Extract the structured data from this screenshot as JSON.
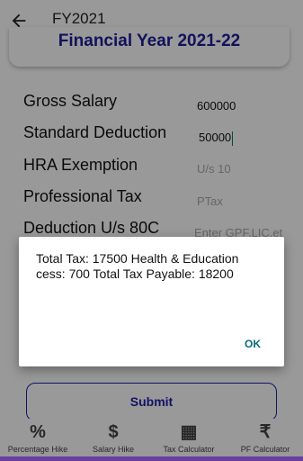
{
  "appbar": {
    "title": "FY2021",
    "back_icon": "arrow-left-icon"
  },
  "card": {
    "title": "Financial Year 2021-22"
  },
  "form": {
    "rows": [
      {
        "label": "Gross Salary",
        "value": "600000",
        "placeholder": ""
      },
      {
        "label": "Standard Deduction",
        "value": "50000",
        "placeholder": ""
      },
      {
        "label": "HRA Exemption",
        "value": "",
        "placeholder": "U/s 10"
      },
      {
        "label": "Professional Tax",
        "value": "",
        "placeholder": "PTax"
      },
      {
        "label": "Deduction U/s 80C",
        "value": "",
        "placeholder": "Enter GPF,LIC,et"
      }
    ],
    "submit_label": "Submit"
  },
  "bottom_nav": [
    {
      "icon": "percent-icon",
      "glyph": "%",
      "label": "Percentage Hike"
    },
    {
      "icon": "dollar-icon",
      "glyph": "$",
      "label": "Salary Hike"
    },
    {
      "icon": "calculator-icon",
      "glyph": "▦",
      "label": "Tax Calculator"
    },
    {
      "icon": "rupee-icon",
      "glyph": "₹",
      "label": "PF Calculator"
    }
  ],
  "dialog": {
    "message": "Total Tax: 17500 Health & Education cess: 700 Total Tax Payable: 18200",
    "ok_label": "OK"
  },
  "colors": {
    "accent": "#1e1ea8",
    "dialog_button": "#0a6b7a",
    "nav_bar": "#6a3ea0"
  }
}
